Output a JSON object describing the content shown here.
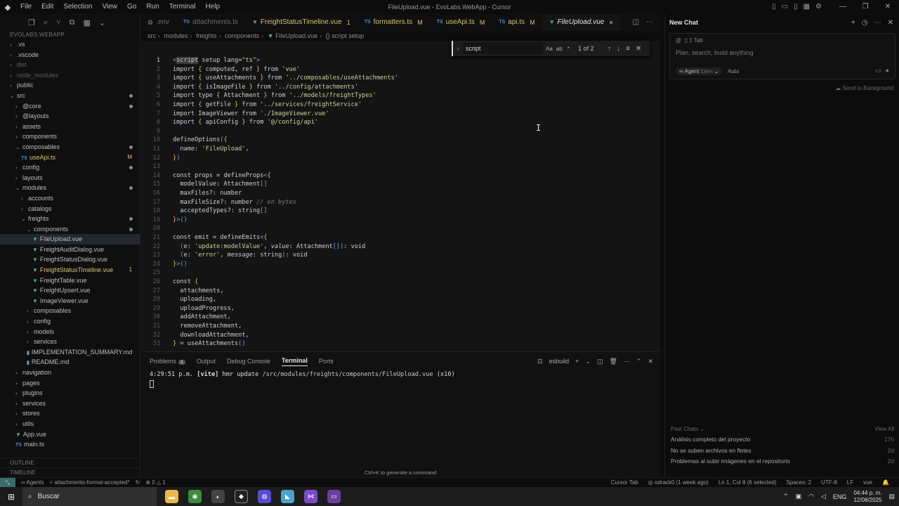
{
  "titlebar": {
    "menu": [
      "File",
      "Edit",
      "Selection",
      "View",
      "Go",
      "Run",
      "Terminal",
      "Help"
    ],
    "title": "FileUpload.vue - EvoLabs.WebApp - Cursor"
  },
  "explorer": {
    "root": "EVOLABS.WEBAPP",
    "items": [
      {
        "label": ".vs",
        "depth": 1,
        "type": "folder",
        "state": ""
      },
      {
        "label": ".vscode",
        "depth": 1,
        "type": "folder",
        "state": ""
      },
      {
        "label": "dist",
        "depth": 1,
        "type": "folder",
        "state": "dim"
      },
      {
        "label": "node_modules",
        "depth": 1,
        "type": "folder",
        "state": "dim"
      },
      {
        "label": "public",
        "depth": 1,
        "type": "folder",
        "state": ""
      },
      {
        "label": "src",
        "depth": 1,
        "type": "folder-open",
        "state": "",
        "dot": true
      },
      {
        "label": "@core",
        "depth": 2,
        "type": "folder",
        "state": "",
        "dot": true
      },
      {
        "label": "@layouts",
        "depth": 2,
        "type": "folder",
        "state": ""
      },
      {
        "label": "assets",
        "depth": 2,
        "type": "folder",
        "state": ""
      },
      {
        "label": "components",
        "depth": 2,
        "type": "folder",
        "state": ""
      },
      {
        "label": "composables",
        "depth": 2,
        "type": "folder-open",
        "state": "",
        "dot": true
      },
      {
        "label": "useApi.ts",
        "depth": 3,
        "type": "ts",
        "state": "mod",
        "badge": "M"
      },
      {
        "label": "config",
        "depth": 2,
        "type": "folder",
        "state": "",
        "dot": true
      },
      {
        "label": "layouts",
        "depth": 2,
        "type": "folder",
        "state": ""
      },
      {
        "label": "modules",
        "depth": 2,
        "type": "folder-open",
        "state": "",
        "dot": true
      },
      {
        "label": "accounts",
        "depth": 3,
        "type": "folder",
        "state": ""
      },
      {
        "label": "catalogs",
        "depth": 3,
        "type": "folder",
        "state": ""
      },
      {
        "label": "freights",
        "depth": 3,
        "type": "folder-open",
        "state": "",
        "dot": true
      },
      {
        "label": "components",
        "depth": 4,
        "type": "folder-open",
        "state": "",
        "dot": true
      },
      {
        "label": "FileUpload.vue",
        "depth": 5,
        "type": "vue",
        "state": "active"
      },
      {
        "label": "FreightAuditDialog.vue",
        "depth": 5,
        "type": "vue",
        "state": ""
      },
      {
        "label": "FreightStatusDialog.vue",
        "depth": 5,
        "type": "vue",
        "state": ""
      },
      {
        "label": "FreightStatusTimeline.vue",
        "depth": 5,
        "type": "vue",
        "state": "err",
        "badge": "1"
      },
      {
        "label": "FreightTable.vue",
        "depth": 5,
        "type": "vue",
        "state": ""
      },
      {
        "label": "FreightUpsert.vue",
        "depth": 5,
        "type": "vue",
        "state": ""
      },
      {
        "label": "ImageViewer.vue",
        "depth": 5,
        "type": "vue",
        "state": ""
      },
      {
        "label": "composables",
        "depth": 4,
        "type": "folder",
        "state": ""
      },
      {
        "label": "config",
        "depth": 4,
        "type": "folder",
        "state": ""
      },
      {
        "label": "models",
        "depth": 4,
        "type": "folder",
        "state": ""
      },
      {
        "label": "services",
        "depth": 4,
        "type": "folder",
        "state": ""
      },
      {
        "label": "IMPLEMENTATION_SUMMARY.md",
        "depth": 4,
        "type": "md",
        "state": ""
      },
      {
        "label": "README.md",
        "depth": 4,
        "type": "md",
        "state": ""
      },
      {
        "label": "navigation",
        "depth": 2,
        "type": "folder",
        "state": ""
      },
      {
        "label": "pages",
        "depth": 2,
        "type": "folder",
        "state": ""
      },
      {
        "label": "plugins",
        "depth": 2,
        "type": "folder",
        "state": ""
      },
      {
        "label": "services",
        "depth": 2,
        "type": "folder",
        "state": ""
      },
      {
        "label": "stores",
        "depth": 2,
        "type": "folder",
        "state": ""
      },
      {
        "label": "utils",
        "depth": 2,
        "type": "folder",
        "state": ""
      },
      {
        "label": "App.vue",
        "depth": 2,
        "type": "vue",
        "state": ""
      },
      {
        "label": "main.ts",
        "depth": 2,
        "type": "ts",
        "state": ""
      }
    ],
    "outline": "OUTLINE",
    "timeline": "TIMELINE"
  },
  "tabs": [
    {
      "label": ".env",
      "kind": "gear",
      "status": "",
      "state": "dim"
    },
    {
      "label": "attachments.ts",
      "kind": "ts",
      "status": "",
      "state": "dim"
    },
    {
      "label": "FreightStatusTimeline.vue",
      "kind": "vue",
      "status": "1",
      "state": "err"
    },
    {
      "label": "formatters.ts",
      "kind": "ts",
      "status": "M",
      "state": "mod"
    },
    {
      "label": "useApi.ts",
      "kind": "ts",
      "status": "M",
      "state": "mod"
    },
    {
      "label": "api.ts",
      "kind": "ts",
      "status": "M",
      "state": "mod"
    },
    {
      "label": "FileUpload.vue",
      "kind": "vue",
      "status": "×",
      "state": "active"
    }
  ],
  "breadcrumb": [
    "src",
    "modules",
    "freights",
    "components",
    "FileUpload.vue",
    "{} script setup"
  ],
  "find": {
    "query": "script",
    "count": "1 of 2",
    "case": "Aa",
    "word": "ab",
    "regex": ".*"
  },
  "editor": {
    "lines": [
      "<script setup lang=\"ts\">",
      "import { computed, ref } from 'vue'",
      "import { useAttachments } from '../composables/useAttachments'",
      "import { isImageFile } from '../config/attachments'",
      "import type { Attachment } from '../models/freightTypes'",
      "import { getFile } from '../services/freightService'",
      "import ImageViewer from './ImageViewer.vue'",
      "import { apiConfig } from '@/config/api'",
      "",
      "defineOptions({",
      "  name: 'FileUpload',",
      "})",
      "",
      "const props = defineProps<{",
      "  modelValue: Attachment[]",
      "  maxFiles?: number",
      "  maxFileSize?: number // en bytes",
      "  acceptedTypes?: string[]",
      "}>()",
      "",
      "const emit = defineEmits<{",
      "  (e: 'update:modelValue', value: Attachment[]): void",
      "  (e: 'error', message: string): void",
      "}>()",
      "",
      "const {",
      "  attachments,",
      "  uploading,",
      "  uploadProgress,",
      "  addAttachment,",
      "  removeAttachment,",
      "  downloadAttachment,",
      "} = useAttachments()"
    ]
  },
  "panel": {
    "tabs": [
      "Problems",
      "Output",
      "Debug Console",
      "Terminal",
      "Ports"
    ],
    "problems_count": "1",
    "active": "Terminal",
    "shell": "esbuild",
    "time": "4:29:51 p.m.",
    "vite": "[vite]",
    "message": "hmr update",
    "path": "/src/modules/freights/components/FileUpload.vue",
    "suffix": "(x10)",
    "hint": "Ctrl+K to generate a command"
  },
  "chat": {
    "title": "New Chat",
    "tab_chip": "1 Tab",
    "placeholder": "Plan, search, build anything",
    "agent": "Agent",
    "agent_shortcut": "Ctrl+I",
    "model": "Auto",
    "send_bg": "Send to Background",
    "past_header": "Past Chats",
    "view_all": "View All",
    "past": [
      {
        "title": "Análisis completo del proyecto",
        "time": "17h"
      },
      {
        "title": "No se suben archivos en fletes",
        "time": "2d"
      },
      {
        "title": "Problemas al subir imágenes en el repositorio",
        "time": "2d"
      }
    ]
  },
  "status": {
    "agents": "Agents",
    "branch": "attachments-format-accepted*",
    "errors": "0",
    "warnings": "1",
    "cursor_tab": "Cursor Tab",
    "blame": "odrack0 (1 week ago)",
    "position": "Ln 1, Col 8 (6 selected)",
    "spaces": "Spaces: 2",
    "encoding": "UTF-8",
    "eol": "LF",
    "language": "vue"
  },
  "taskbar": {
    "search": "Buscar",
    "lang": "ENG",
    "time": "04:44 p. m.",
    "date": "12/08/2025"
  }
}
